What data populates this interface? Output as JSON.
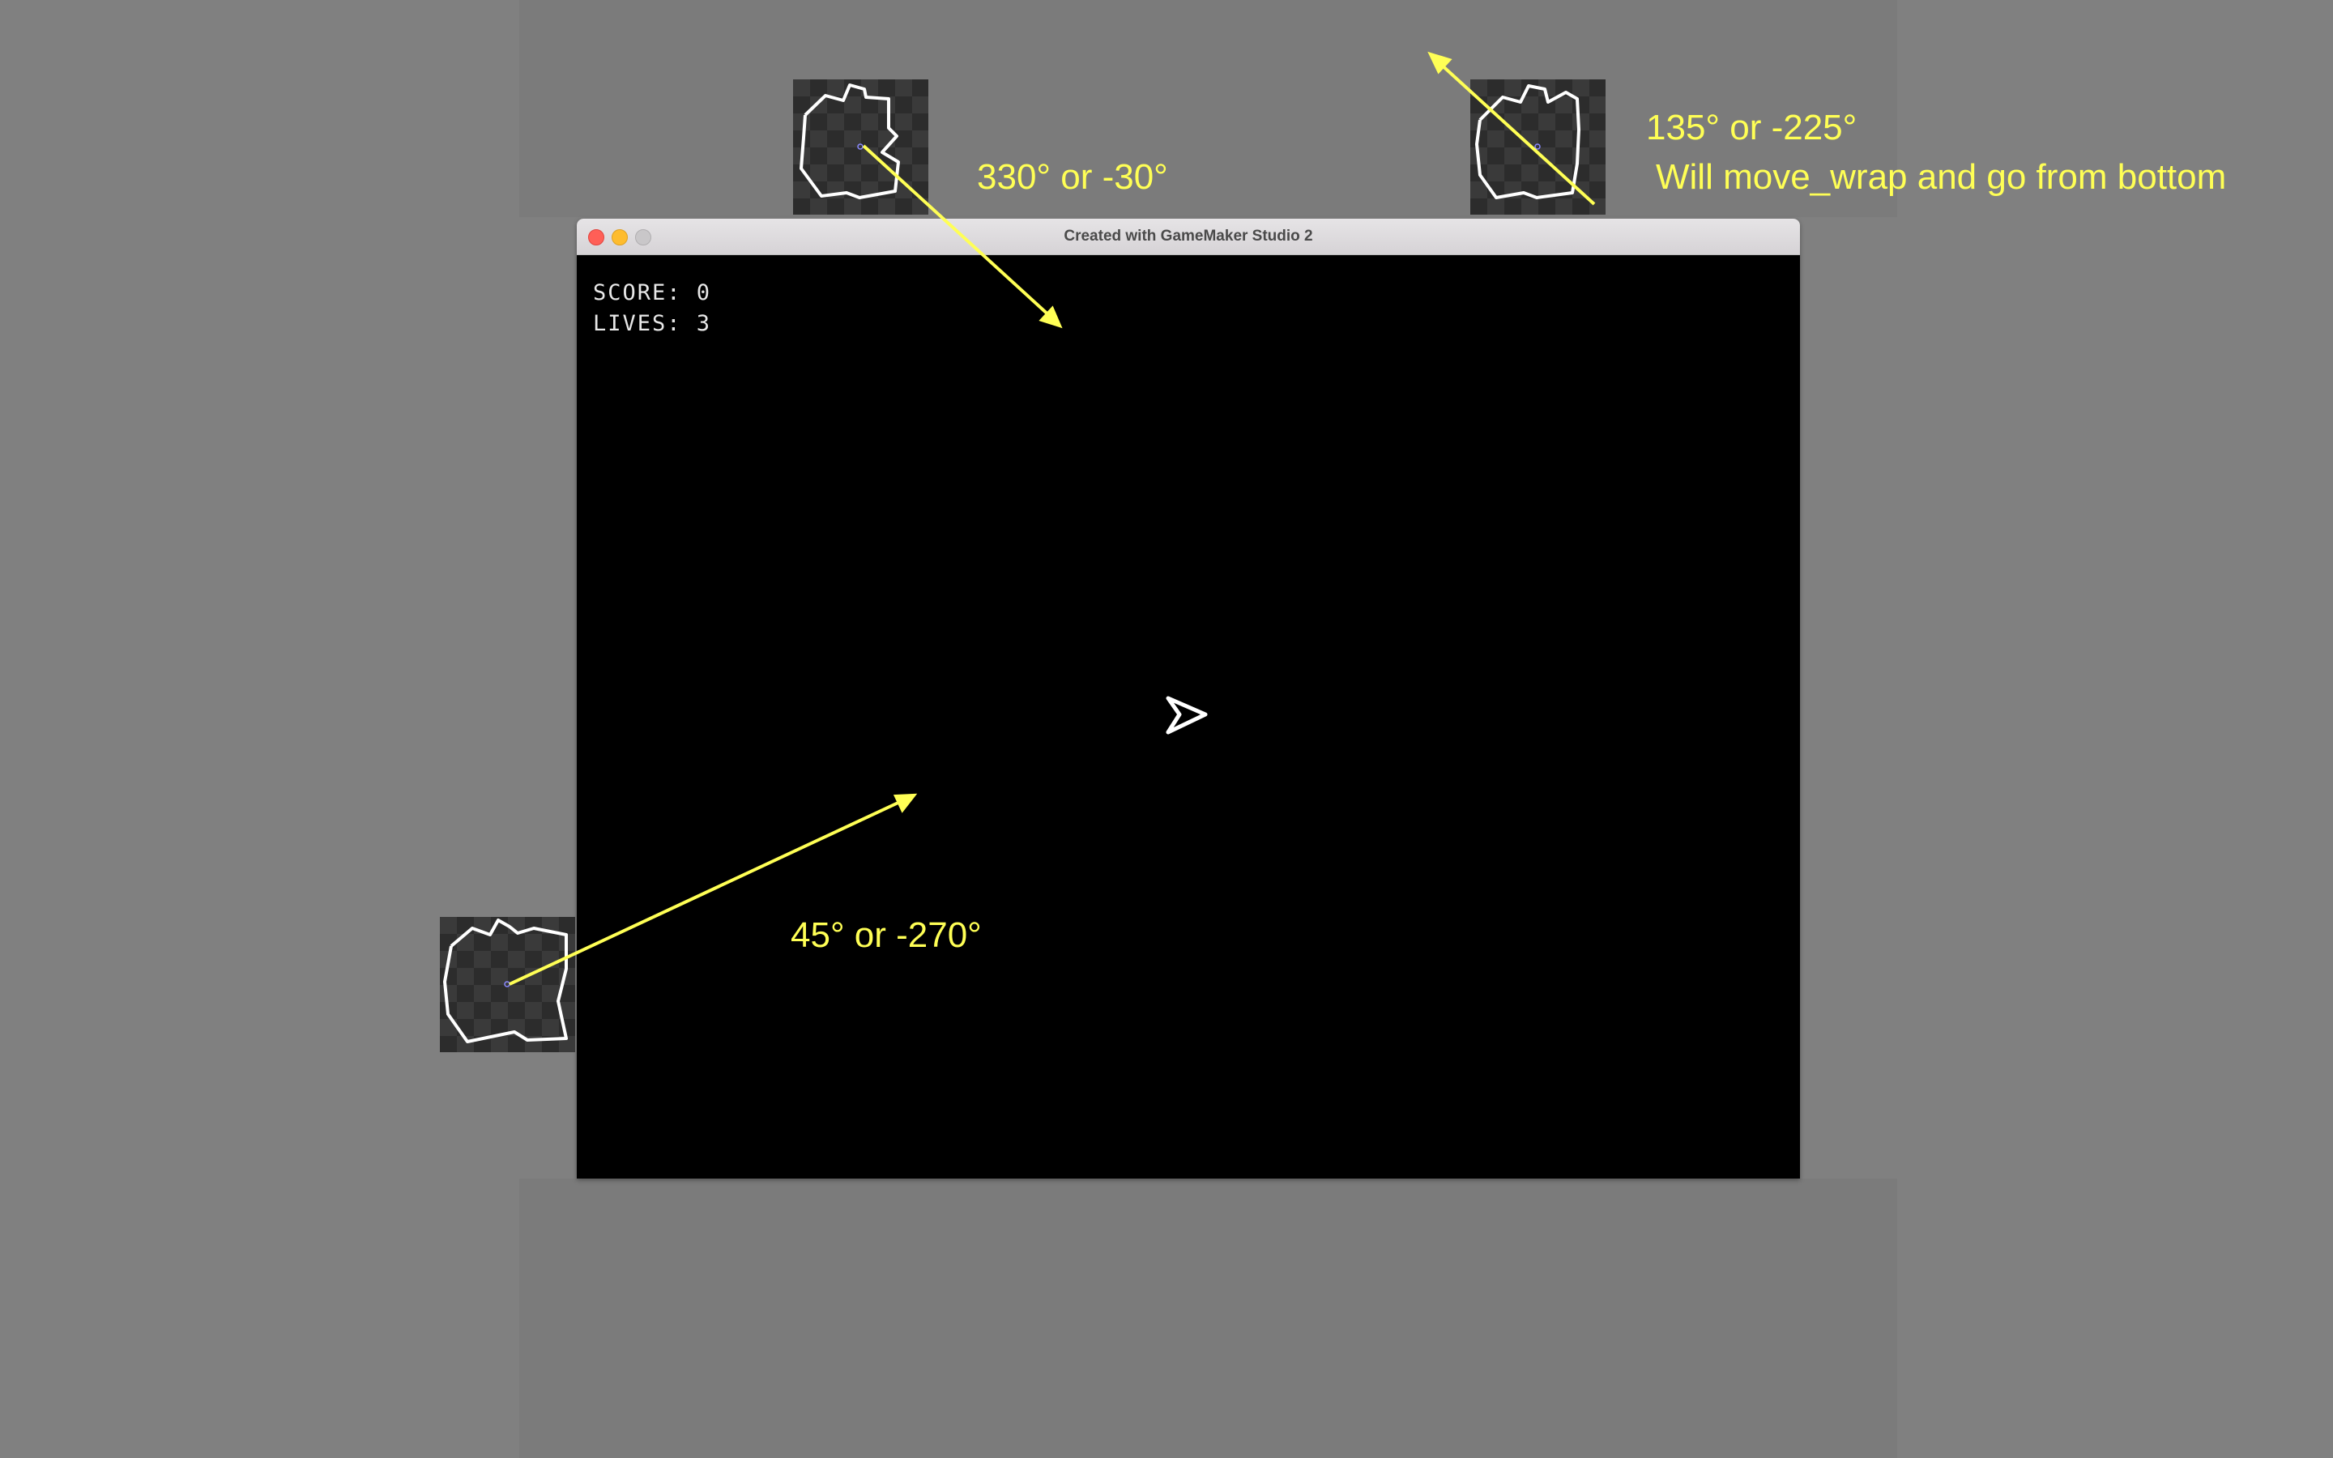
{
  "window": {
    "title": "Created with GameMaker Studio 2",
    "controls": [
      "close",
      "minimize",
      "zoom"
    ]
  },
  "hud": {
    "score": "SCORE: 0",
    "lives": "LIVES: 3"
  },
  "annotations": {
    "a330": "330° or -30°",
    "a135": "135° or -225°",
    "wrap_note": "Will move_wrap and go from bottom",
    "a45": "45° or -270°"
  },
  "icons": {
    "player_ship": "arrowhead-ship-icon",
    "asteroid": "asteroid-outline-icon"
  },
  "colors": {
    "backdrop": "#808080",
    "game_background": "#000000",
    "annotation": "#ffff55",
    "hud_text": "#e8e8e8"
  }
}
